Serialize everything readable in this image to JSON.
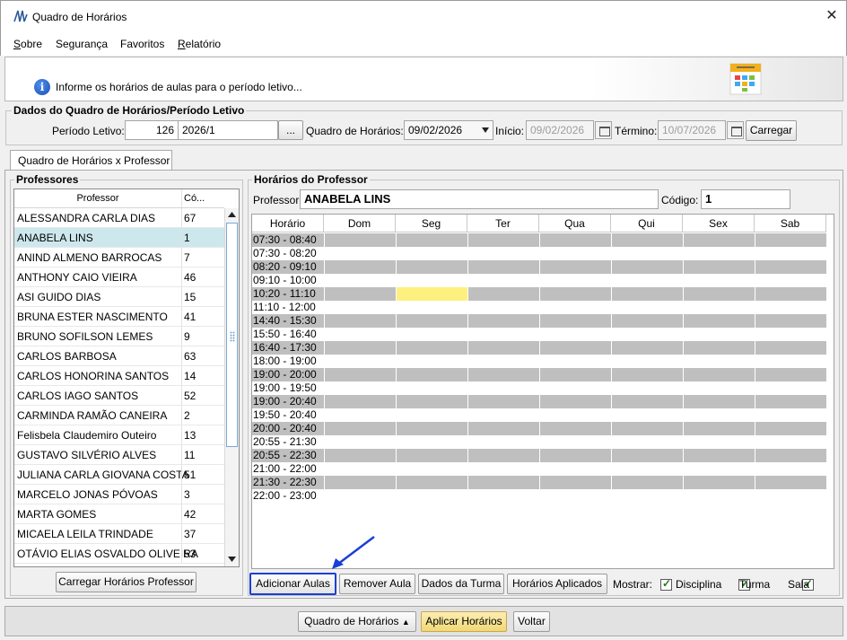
{
  "window": {
    "title": "Quadro de Horários"
  },
  "menu": {
    "items": [
      {
        "label": "Sobre",
        "ul": "S",
        "rest": "obre"
      },
      {
        "label": "Segurança",
        "ul": "",
        "rest": "Segurança"
      },
      {
        "label": "Favoritos",
        "ul": "",
        "rest": "Favoritos"
      },
      {
        "label": "Relatório",
        "ul": "R",
        "rest": "elatório"
      }
    ]
  },
  "info": {
    "text": "Informe os horários de aulas para o período letivo..."
  },
  "dados": {
    "legend": "Dados do Quadro de Horários/Período Letivo",
    "periodo_label": "Período Letivo:",
    "periodo_code": "126",
    "periodo_value": "2026/1",
    "ellipsis": "...",
    "quadro_label": "Quadro de Horários:",
    "quadro_value": "09/02/2026",
    "inicio_label": "Início:",
    "inicio_value": "09/02/2026",
    "termino_label": "Término:",
    "termino_value": "10/07/2026",
    "carregar": "Carregar"
  },
  "tab": {
    "label": "Quadro de Horários x Professor"
  },
  "professores": {
    "legend": "Professores",
    "col_professor": "Professor",
    "col_codigo": "Có...",
    "rows": [
      {
        "name": "ALESSANDRA CARLA DIAS",
        "code": "67"
      },
      {
        "name": "ANABELA LINS",
        "code": "1"
      },
      {
        "name": "ANIND ALMENO BARROCAS",
        "code": "7"
      },
      {
        "name": "ANTHONY CAIO VIEIRA",
        "code": "46"
      },
      {
        "name": "ASI GUIDO DIAS",
        "code": "15"
      },
      {
        "name": "BRUNA ESTER NASCIMENTO",
        "code": "41"
      },
      {
        "name": "BRUNO SOFILSON LEMES",
        "code": "9"
      },
      {
        "name": "CARLOS BARBOSA",
        "code": "63"
      },
      {
        "name": "CARLOS HONORINA SANTOS",
        "code": "14"
      },
      {
        "name": "CARLOS IAGO SANTOS",
        "code": "52"
      },
      {
        "name": "CARMINDA RAMÃO CANEIRA",
        "code": "2"
      },
      {
        "name": "Felisbela Claudemiro Outeiro",
        "code": "13"
      },
      {
        "name": "GUSTAVO SILVÉRIO ALVES",
        "code": "11"
      },
      {
        "name": "JULIANA CARLA GIOVANA COSTA",
        "code": "51"
      },
      {
        "name": "MARCELO JONAS PÓVOAS",
        "code": "3"
      },
      {
        "name": "MARTA GOMES",
        "code": "42"
      },
      {
        "name": "MICAELA LEILA TRINDADE",
        "code": "37"
      },
      {
        "name": "OTÁVIO ELIAS OSVALDO OLIVEIRA",
        "code": "53"
      }
    ],
    "carregar_btn": "Carregar Horários Professor"
  },
  "horarios": {
    "legend": "Horários do Professor",
    "professor_label": "Professor:",
    "professor_value": "ANABELA LINS",
    "codigo_label": "Código:",
    "codigo_value": "1",
    "headers": [
      "Horário",
      "Dom",
      "Seg",
      "Ter",
      "Qua",
      "Qui",
      "Sex",
      "Sab"
    ],
    "rows": [
      {
        "time": "07:30 - 08:40",
        "gray": true
      },
      {
        "time": "07:30 - 08:20",
        "gray": false
      },
      {
        "time": "08:20 - 09:10",
        "gray": true
      },
      {
        "time": "09:10 - 10:00",
        "gray": false
      },
      {
        "time": "10:20 - 11:10",
        "gray": true
      },
      {
        "time": "11:10 - 12:00",
        "gray": false
      },
      {
        "time": "14:40 - 15:30",
        "gray": true
      },
      {
        "time": "15:50 - 16:40",
        "gray": false
      },
      {
        "time": "16:40 - 17:30",
        "gray": true
      },
      {
        "time": "18:00 - 19:00",
        "gray": false
      },
      {
        "time": "19:00 - 20:00",
        "gray": true
      },
      {
        "time": "19:00 - 19:50",
        "gray": false
      },
      {
        "time": "19:00 - 20:40",
        "gray": true
      },
      {
        "time": "19:50 - 20:40",
        "gray": false
      },
      {
        "time": "20:00 - 20:40",
        "gray": true
      },
      {
        "time": "20:55 - 21:30",
        "gray": false
      },
      {
        "time": "20:55 - 22:30",
        "gray": true
      },
      {
        "time": "21:00 - 22:00",
        "gray": false
      },
      {
        "time": "21:30 - 22:30",
        "gray": true
      },
      {
        "time": "22:00 - 23:00",
        "gray": false
      }
    ],
    "highlight": {
      "row": 4,
      "col": 2,
      "color": "#fdf07f"
    }
  },
  "actions": {
    "adicionar": "Adicionar Aulas",
    "remover": "Remover Aula",
    "dados_turma": "Dados da Turma",
    "horarios_aplicados": "Horários Aplicados",
    "mostrar_label": "Mostrar:",
    "disciplina": "Disciplina",
    "turma": "Turma",
    "sala": "Sala"
  },
  "bottom": {
    "quadro_btn": "Quadro de Horários",
    "aplicar_btn": "Aplicar Horários",
    "voltar_btn": "Voltar"
  },
  "colors": {
    "accent_focus": "#1a3fd6",
    "arrow": "#1a3fd6",
    "selected_row": "#cde8ec",
    "gray_row": "#bfbfbf",
    "highlight": "#fdf07f",
    "aplicar_bg": "#f7e59a"
  }
}
